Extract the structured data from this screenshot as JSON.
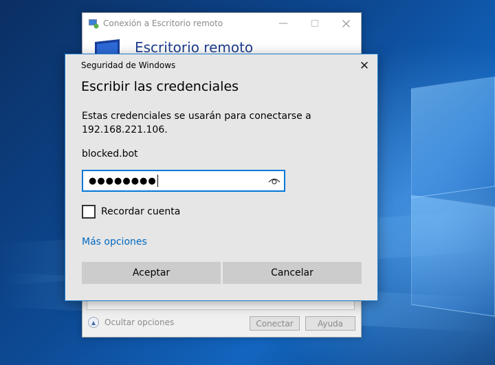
{
  "rdp_window": {
    "title": "Conexión a Escritorio remoto",
    "banner_title": "Escritorio remoto",
    "hide_options_label": "Ocultar opciones",
    "connect_label": "Conectar",
    "help_label": "Ayuda",
    "window_controls": [
      "minimize-icon",
      "maximize-icon",
      "close-icon"
    ]
  },
  "security_dialog": {
    "header": "Seguridad de Windows",
    "title": "Escribir las credenciales",
    "message": "Estas credenciales se usarán para conectarse a 192.168.221.106.",
    "username": "blocked.bot",
    "password_masked": "●●●●●●●●",
    "remember_label": "Recordar cuenta",
    "remember_checked": false,
    "more_options_label": "Más opciones",
    "ok_label": "Aceptar",
    "cancel_label": "Cancelar",
    "close_glyph": "✕",
    "icons": [
      "close-icon",
      "reveal-password-icon"
    ]
  },
  "colors": {
    "accent": "#0078d7",
    "link": "#0067c0",
    "dialog_bg": "#e6e6e6",
    "button_bg": "#cccccc"
  }
}
